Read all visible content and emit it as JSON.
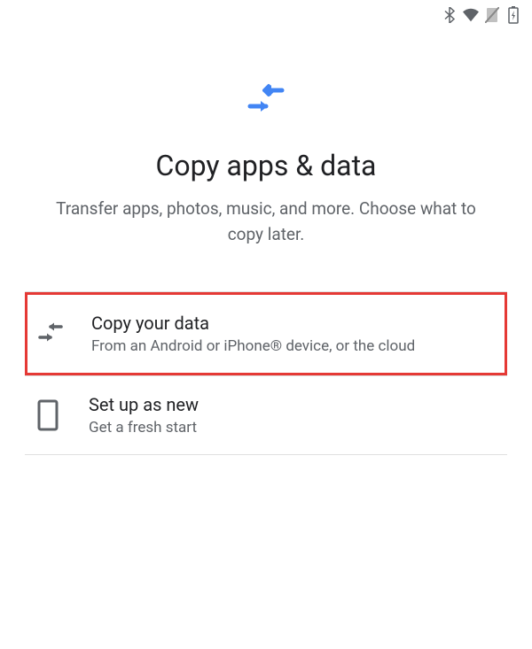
{
  "hero": {
    "title": "Copy apps & data",
    "subtitle": "Transfer apps, photos, music, and more. Choose what to copy later."
  },
  "options": [
    {
      "title": "Copy your data",
      "subtitle": "From an Android or iPhone® device, or the cloud",
      "highlighted": true
    },
    {
      "title": "Set up as new",
      "subtitle": "Get a fresh start",
      "highlighted": false
    }
  ]
}
